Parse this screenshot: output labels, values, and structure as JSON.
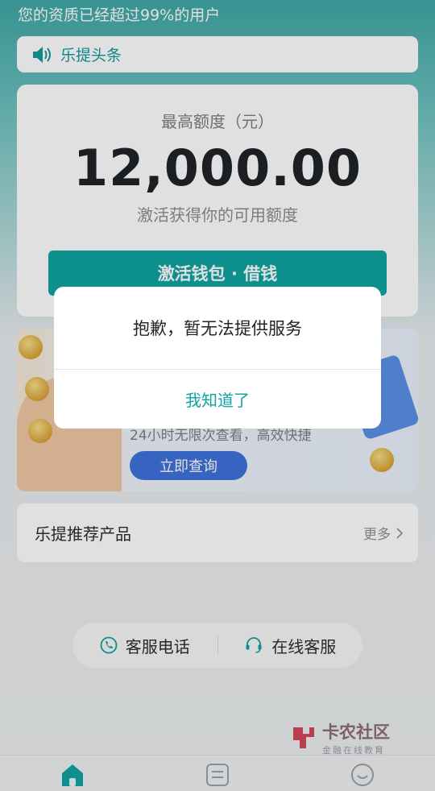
{
  "header": {
    "qualification_text": "您的资质已经超过99%的用户"
  },
  "news": {
    "label": "乐提头条",
    "icon": "speaker-icon"
  },
  "limit_card": {
    "title": "最高额度（元）",
    "amount": "12,000.00",
    "subtitle": "激活获得你的可用额度",
    "button_label": "激活钱包 · 借钱"
  },
  "banner": {
    "sub_text": "24小时无限次查看，高效快捷",
    "button_label": "立即查询"
  },
  "recommend": {
    "title": "乐提推荐产品",
    "more_label": "更多"
  },
  "service": {
    "phone_label": "客服电话",
    "online_label": "在线客服"
  },
  "watermark": {
    "main": "卡农社区",
    "sub": "金融在线教育"
  },
  "dialog": {
    "message": "抱歉，暂无法提供服务",
    "button_label": "我知道了"
  },
  "colors": {
    "accent": "#0fa3a2",
    "banner_button": "#3f72db"
  }
}
